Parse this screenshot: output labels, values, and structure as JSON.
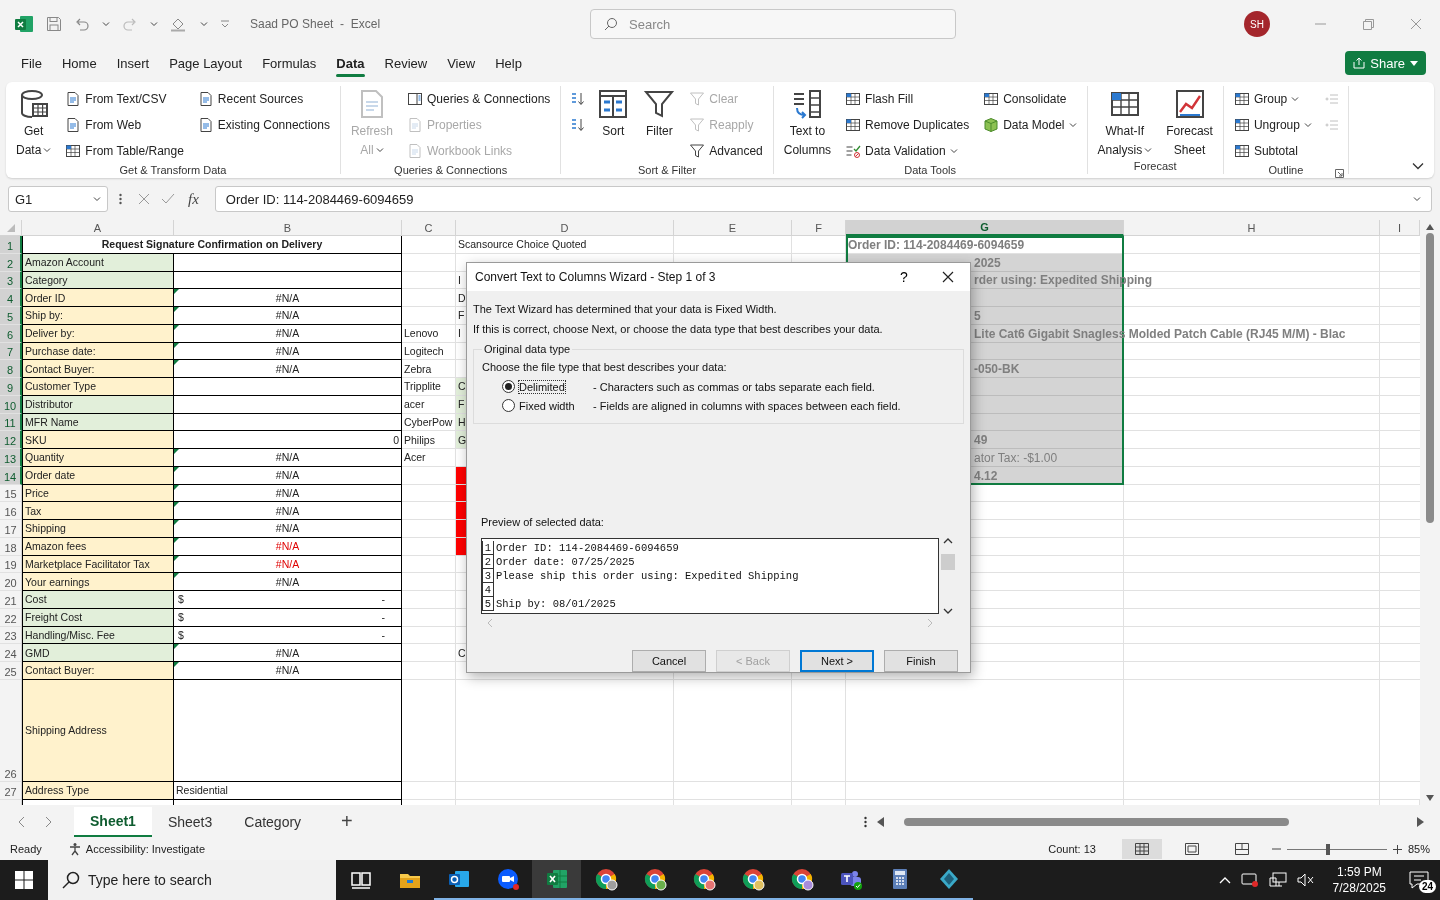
{
  "window": {
    "title": "Saad PO Sheet  -  Excel",
    "search_placeholder": "Search",
    "avatar": "SH"
  },
  "menu": [
    {
      "label": "File",
      "selected": false
    },
    {
      "label": "Home",
      "selected": false
    },
    {
      "label": "Insert",
      "selected": false
    },
    {
      "label": "Page Layout",
      "selected": false
    },
    {
      "label": "Formulas",
      "selected": false
    },
    {
      "label": "Data",
      "selected": true
    },
    {
      "label": "Review",
      "selected": false
    },
    {
      "label": "View",
      "selected": false
    },
    {
      "label": "Help",
      "selected": false
    }
  ],
  "share": "Share",
  "ribbon": [
    {
      "label": "Get & Transform Data",
      "columns": [
        [
          {
            "kind": "large",
            "lines": [
              "Get",
              "Data"
            ],
            "dropdown": true,
            "disabled": false
          }
        ],
        [
          {
            "kind": "small",
            "label": "From Text/CSV",
            "dropdown": false,
            "disabled": false
          },
          {
            "kind": "small",
            "label": "From Web",
            "dropdown": false,
            "disabled": false
          },
          {
            "kind": "small",
            "label": "From Table/Range",
            "dropdown": false,
            "disabled": false
          }
        ],
        [
          {
            "kind": "small",
            "label": "Recent Sources",
            "dropdown": false,
            "disabled": false
          },
          {
            "kind": "small",
            "label": "Existing Connections",
            "dropdown": false,
            "disabled": false
          }
        ]
      ]
    },
    {
      "label": "Queries & Connections",
      "columns": [
        [
          {
            "kind": "large",
            "lines": [
              "Refresh",
              "All"
            ],
            "dropdown": true,
            "disabled": true
          }
        ],
        [
          {
            "kind": "small",
            "label": "Queries & Connections",
            "dropdown": false,
            "disabled": false
          },
          {
            "kind": "small",
            "label": "Properties",
            "dropdown": false,
            "disabled": true
          },
          {
            "kind": "small",
            "label": "Workbook Links",
            "dropdown": false,
            "disabled": true
          }
        ]
      ]
    },
    {
      "label": "Sort & Filter",
      "columns": [
        [
          {
            "kind": "icon",
            "dropdown": false,
            "disabled": false
          },
          {
            "kind": "icon",
            "dropdown": false,
            "disabled": false
          }
        ],
        [
          {
            "kind": "large",
            "lines": [
              "Sort"
            ],
            "dropdown": false,
            "disabled": false
          }
        ],
        [
          {
            "kind": "large",
            "lines": [
              "Filter"
            ],
            "dropdown": false,
            "disabled": false
          }
        ],
        [
          {
            "kind": "small",
            "label": "Clear",
            "dropdown": false,
            "disabled": true
          },
          {
            "kind": "small",
            "label": "Reapply",
            "dropdown": false,
            "disabled": true
          },
          {
            "kind": "small",
            "label": "Advanced",
            "dropdown": false,
            "disabled": false
          }
        ]
      ]
    },
    {
      "label": "Data Tools",
      "columns": [
        [
          {
            "kind": "large",
            "lines": [
              "Text to",
              "Columns"
            ],
            "dropdown": false,
            "disabled": false
          }
        ],
        [
          {
            "kind": "small",
            "label": "Flash Fill",
            "dropdown": false,
            "disabled": false
          },
          {
            "kind": "small",
            "label": "Remove Duplicates",
            "dropdown": false,
            "disabled": false
          },
          {
            "kind": "small",
            "label": "Data Validation",
            "dropdown": true,
            "disabled": false
          }
        ],
        [
          {
            "kind": "small",
            "label": "Consolidate",
            "dropdown": false,
            "disabled": false
          },
          {
            "kind": "small",
            "label": "Data Model",
            "dropdown": true,
            "disabled": false
          }
        ]
      ]
    },
    {
      "label": "Forecast",
      "columns": [
        [
          {
            "kind": "large",
            "lines": [
              "What-If",
              "Analysis"
            ],
            "dropdown": true,
            "disabled": false
          }
        ],
        [
          {
            "kind": "large",
            "lines": [
              "Forecast",
              "Sheet"
            ],
            "dropdown": false,
            "disabled": false
          }
        ]
      ]
    },
    {
      "label": "Outline",
      "columns": [
        [
          {
            "kind": "small",
            "label": "Group",
            "dropdown": true,
            "disabled": false
          },
          {
            "kind": "small",
            "label": "Ungroup",
            "dropdown": true,
            "disabled": false
          },
          {
            "kind": "small",
            "label": "Subtotal",
            "dropdown": false,
            "disabled": false
          }
        ],
        [
          {
            "kind": "icon",
            "dropdown": false,
            "disabled": true
          },
          {
            "kind": "icon",
            "dropdown": false,
            "disabled": true
          }
        ]
      ]
    }
  ],
  "formula_bar": {
    "name_box": "G1",
    "fx": "fx",
    "formula": "Order ID: 114-2084469-6094659"
  },
  "columns": [
    {
      "label": "A",
      "selected": false
    },
    {
      "label": "B",
      "selected": false
    },
    {
      "label": "C",
      "selected": false
    },
    {
      "label": "D",
      "selected": false
    },
    {
      "label": "E",
      "selected": false
    },
    {
      "label": "F",
      "selected": false
    },
    {
      "label": "G",
      "selected": true
    },
    {
      "label": "H",
      "selected": false
    },
    {
      "label": "I",
      "selected": false
    }
  ],
  "rows": [
    {
      "number": "1",
      "selected": true,
      "kind": "normal",
      "A": {
        "kind": "title",
        "text": "Request Signature Confirmation on Delivery"
      },
      "D": {
        "text": "Scansource Choice Quoted"
      },
      "G": {
        "kind": "bold",
        "text": "Order ID: 114-2084469-6094659"
      }
    },
    {
      "number": "2",
      "selected": true,
      "kind": "normal",
      "A": {
        "kind": "label",
        "text": "Amazon Account",
        "color": "#e2efda"
      },
      "G": {
        "kind": "bold",
        "text": "2025"
      }
    },
    {
      "number": "3",
      "selected": true,
      "kind": "normal",
      "A": {
        "kind": "label",
        "text": "Category",
        "color": "#e2efda"
      },
      "D": {
        "text": "I"
      },
      "G": {
        "kind": "bold",
        "text": "rder using: Expedited Shipping"
      }
    },
    {
      "number": "4",
      "selected": true,
      "kind": "normal",
      "A": {
        "kind": "label",
        "text": "Order ID",
        "color": "#fff2cc"
      },
      "B": {
        "kind": "error",
        "text": "#N/A",
        "marked": true,
        "warning": false
      },
      "D": {
        "text": "D"
      }
    },
    {
      "number": "5",
      "selected": true,
      "kind": "normal",
      "A": {
        "kind": "label",
        "text": "Ship by:",
        "color": "#fff2cc"
      },
      "B": {
        "kind": "error",
        "text": "#N/A",
        "marked": true,
        "warning": false
      },
      "D": {
        "text": "F"
      },
      "G": {
        "kind": "bold",
        "text": "5"
      }
    },
    {
      "number": "6",
      "selected": true,
      "kind": "normal",
      "A": {
        "kind": "label",
        "text": "Deliver by:",
        "color": "#fff2cc"
      },
      "B": {
        "kind": "error",
        "text": "#N/A",
        "marked": true,
        "warning": false
      },
      "C": {
        "text": "Lenovo"
      },
      "D": {
        "text": "I"
      },
      "G": {
        "kind": "bold",
        "text": "Lite Cat6 Gigabit Snagless Molded Patch Cable (RJ45 M/M) - Blac"
      }
    },
    {
      "number": "7",
      "selected": true,
      "kind": "normal",
      "A": {
        "kind": "label",
        "text": "Purchase date:",
        "color": "#fff2cc"
      },
      "B": {
        "kind": "error",
        "text": "#N/A",
        "marked": true,
        "warning": false
      },
      "C": {
        "text": "Logitech"
      }
    },
    {
      "number": "8",
      "selected": true,
      "kind": "normal",
      "A": {
        "kind": "label",
        "text": "Contact Buyer:",
        "color": "#fff2cc"
      },
      "B": {
        "kind": "error",
        "text": "#N/A",
        "marked": true,
        "warning": false
      },
      "C": {
        "text": "Zebra"
      },
      "G": {
        "kind": "bold",
        "text": "-050-BK"
      }
    },
    {
      "number": "9",
      "selected": true,
      "kind": "normal",
      "A": {
        "kind": "label",
        "text": "Customer Type",
        "color": "#fff2cc"
      },
      "C": {
        "text": "Tripplite"
      },
      "D": {
        "text": "C",
        "color": "#e2efda"
      }
    },
    {
      "number": "10",
      "selected": true,
      "kind": "normal",
      "A": {
        "kind": "label",
        "text": "Distributor",
        "color": "#e2efda"
      },
      "C": {
        "text": "acer"
      },
      "D": {
        "text": "F",
        "color": "#e2efda"
      }
    },
    {
      "number": "11",
      "selected": true,
      "kind": "normal",
      "A": {
        "kind": "label",
        "text": "MFR Name",
        "color": "#e2efda"
      },
      "C": {
        "text": "CyberPow"
      },
      "D": {
        "text": "H",
        "color": "#e2efda"
      }
    },
    {
      "number": "12",
      "selected": true,
      "kind": "normal",
      "A": {
        "kind": "label",
        "text": "SKU",
        "color": "#fff2cc"
      },
      "B": {
        "kind": "number",
        "text": "0",
        "marked": false,
        "warning": false
      },
      "C": {
        "text": "Philips"
      },
      "D": {
        "text": "G",
        "color": "#e2efda"
      },
      "G": {
        "kind": "bold",
        "text": "49"
      }
    },
    {
      "number": "13",
      "selected": true,
      "kind": "normal",
      "A": {
        "kind": "label",
        "text": "Quantity",
        "color": "#fff2cc"
      },
      "B": {
        "kind": "error",
        "text": "#N/A",
        "marked": true,
        "warning": false
      },
      "C": {
        "text": "Acer"
      },
      "G": {
        "kind": "plain",
        "text": "ator Tax: -$1.00"
      }
    },
    {
      "number": "14",
      "selected": true,
      "kind": "normal",
      "A": {
        "kind": "label",
        "text": "Order date",
        "color": "#fff2cc"
      },
      "B": {
        "kind": "error",
        "text": "#N/A",
        "marked": true,
        "warning": false
      },
      "D": {
        "color": "#ff0000"
      },
      "G": {
        "kind": "bold",
        "text": "4.12"
      }
    },
    {
      "number": "15",
      "selected": false,
      "kind": "normal",
      "A": {
        "kind": "label",
        "text": "Price",
        "color": "#fff2cc"
      },
      "B": {
        "kind": "error",
        "text": "#N/A",
        "marked": true,
        "warning": false
      },
      "D": {
        "color": "#ff0000"
      }
    },
    {
      "number": "16",
      "selected": false,
      "kind": "normal",
      "A": {
        "kind": "label",
        "text": "Tax",
        "color": "#fff2cc"
      },
      "B": {
        "kind": "error",
        "text": "#N/A",
        "marked": true,
        "warning": false
      },
      "D": {
        "color": "#ff0000"
      }
    },
    {
      "number": "17",
      "selected": false,
      "kind": "normal",
      "A": {
        "kind": "label",
        "text": "Shipping",
        "color": "#fff2cc"
      },
      "B": {
        "kind": "error",
        "text": "#N/A",
        "marked": true,
        "warning": false
      },
      "D": {
        "color": "#ff0000"
      }
    },
    {
      "number": "18",
      "selected": false,
      "kind": "normal",
      "A": {
        "kind": "label",
        "text": "Amazon fees",
        "color": "#fff2cc"
      },
      "B": {
        "kind": "error",
        "text": "#N/A",
        "marked": true,
        "warning": true
      },
      "D": {
        "color": "#ff0000"
      }
    },
    {
      "number": "19",
      "selected": false,
      "kind": "normal",
      "A": {
        "kind": "label",
        "text": "Marketplace Facilitator Tax",
        "color": "#fff2cc"
      },
      "B": {
        "kind": "error",
        "text": "#N/A",
        "marked": true,
        "warning": true
      }
    },
    {
      "number": "20",
      "selected": false,
      "kind": "normal",
      "A": {
        "kind": "label",
        "text": "Your earnings",
        "color": "#fff2cc"
      },
      "B": {
        "kind": "error",
        "text": "#N/A",
        "marked": true,
        "warning": false
      }
    },
    {
      "number": "21",
      "selected": false,
      "kind": "normal",
      "A": {
        "kind": "label",
        "text": "Cost",
        "color": "#e2efda"
      },
      "B": {
        "kind": "currency",
        "symbol": "$",
        "text": "-",
        "marked": false,
        "warning": false
      }
    },
    {
      "number": "22",
      "selected": false,
      "kind": "normal",
      "A": {
        "kind": "label",
        "text": "Freight Cost",
        "color": "#e2efda"
      },
      "B": {
        "kind": "currency",
        "symbol": "$",
        "text": "-",
        "marked": false,
        "warning": false
      }
    },
    {
      "number": "23",
      "selected": false,
      "kind": "normal",
      "A": {
        "kind": "label",
        "text": "Handling/Misc. Fee",
        "color": "#e2efda"
      },
      "B": {
        "kind": "currency",
        "symbol": "$",
        "text": "-",
        "marked": false,
        "warning": false
      }
    },
    {
      "number": "24",
      "selected": false,
      "kind": "normal",
      "A": {
        "kind": "label",
        "text": "GMD",
        "color": "#e2efda"
      },
      "B": {
        "kind": "error",
        "text": "#N/A",
        "marked": true,
        "warning": false
      },
      "D": {
        "text": "C"
      }
    },
    {
      "number": "25",
      "selected": false,
      "kind": "normal",
      "A": {
        "kind": "label",
        "text": "Contact Buyer:",
        "color": "#fff2cc"
      },
      "B": {
        "kind": "error",
        "text": "#N/A",
        "marked": true,
        "warning": false
      }
    },
    {
      "number": "26",
      "selected": false,
      "kind": "tall",
      "A": {
        "kind": "label",
        "text": "Shipping Address",
        "color": "#fff2cc"
      }
    },
    {
      "number": "27",
      "selected": false,
      "kind": "normal",
      "A": {
        "kind": "label",
        "text": "Address Type",
        "color": "#fff2cc"
      },
      "B": {
        "kind": "text",
        "text": "Residential",
        "marked": false,
        "warning": false
      }
    }
  ],
  "dialog": {
    "title": "Convert Text to Columns Wizard - Step 1 of 3",
    "help": "?",
    "intro": [
      "The Text Wizard has determined that your data is Fixed Width.",
      "If this is correct, choose Next, or choose the data type that best describes your data."
    ],
    "group_title": "Original data type",
    "prompt": "Choose the file type that best describes your data:",
    "options": [
      {
        "label": "Delimited",
        "description": "- Characters such as commas or tabs separate each field.",
        "selected": true
      },
      {
        "label": "Fixed width",
        "description": "- Fields are aligned in columns with spaces between each field.",
        "selected": false
      }
    ],
    "preview_label": "Preview of selected data:",
    "preview": [
      {
        "number": "1",
        "text": "Order ID: 114-2084469-6094659"
      },
      {
        "number": "2",
        "text": "Order date: 07/25/2025"
      },
      {
        "number": "3",
        "text": "Please ship this order using: Expedited Shipping"
      },
      {
        "number": "4"
      },
      {
        "number": "5",
        "text": "Ship by: 08/01/2025"
      }
    ],
    "buttons": [
      {
        "label": "Cancel",
        "disabled": false,
        "default": false
      },
      {
        "label": "< Back",
        "disabled": true,
        "default": false
      },
      {
        "label": "Next >",
        "disabled": false,
        "default": true
      },
      {
        "label": "Finish",
        "disabled": false,
        "default": false
      }
    ]
  },
  "sheet_tabs": [
    {
      "label": "Sheet1",
      "selected": true
    },
    {
      "label": "Sheet3",
      "selected": false
    },
    {
      "label": "Category",
      "selected": false
    }
  ],
  "add_sheet": "+",
  "status_bar": {
    "mode": "Ready",
    "accessibility": "Accessibility: Investigate",
    "count": "Count: 13",
    "views": [
      {
        "selected": true
      },
      {
        "selected": false
      },
      {
        "selected": false
      }
    ],
    "zoom": {
      "level": 0.41
    },
    "zoom_reading": "85%"
  },
  "taskbar": {
    "search_placeholder": "Type here to search",
    "apps": [
      {
        "open": false,
        "active": false
      },
      {
        "open": false,
        "active": false
      },
      {
        "open": true,
        "active": false
      },
      {
        "open": true,
        "active": false
      },
      {
        "open": true,
        "active": true
      },
      {
        "open": true,
        "active": false
      },
      {
        "open": true,
        "active": false
      },
      {
        "open": true,
        "active": false
      },
      {
        "open": true,
        "active": false
      },
      {
        "open": true,
        "active": false
      },
      {
        "open": true,
        "active": false
      },
      {
        "open": true,
        "active": false
      },
      {
        "open": true,
        "active": false
      }
    ],
    "time": "1:59 PM",
    "date": "7/28/2025",
    "notifications": "24"
  }
}
